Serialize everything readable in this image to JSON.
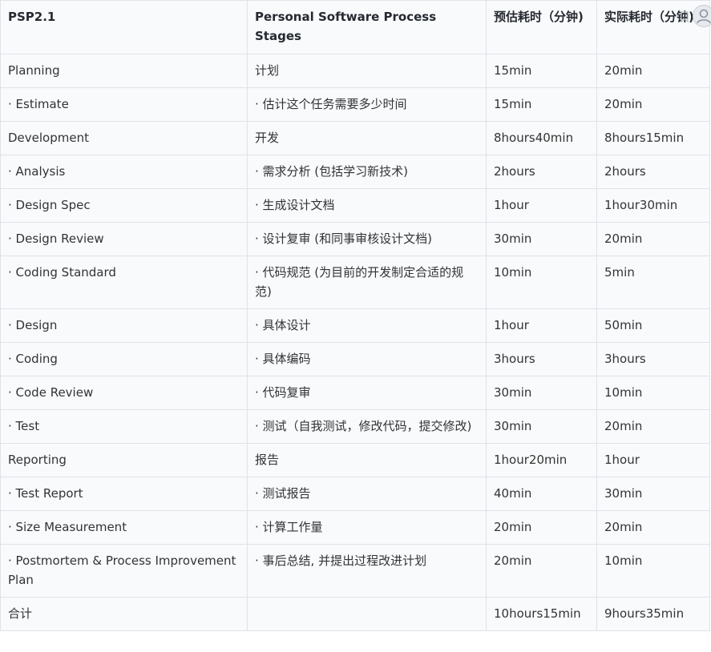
{
  "table": {
    "headers": [
      "PSP2.1",
      "Personal Software Process Stages",
      "预估耗时（分钟)",
      "实际耗时（分钟)"
    ],
    "rows": [
      [
        "Planning",
        "计划",
        "15min",
        "20min"
      ],
      [
        "· Estimate",
        "· 估计这个任务需要多少时间",
        "15min",
        "20min"
      ],
      [
        "Development",
        "开发",
        "8hours40min",
        "8hours15min"
      ],
      [
        "· Analysis",
        "· 需求分析 (包括学习新技术)",
        "2hours",
        "2hours"
      ],
      [
        "· Design Spec",
        "· 生成设计文档",
        "1hour",
        "1hour30min"
      ],
      [
        "· Design Review",
        "· 设计复审 (和同事审核设计文档)",
        "30min",
        "20min"
      ],
      [
        "· Coding Standard",
        "· 代码规范 (为目前的开发制定合适的规范)",
        "10min",
        "5min"
      ],
      [
        "· Design",
        "· 具体设计",
        "1hour",
        "50min"
      ],
      [
        "· Coding",
        "· 具体编码",
        "3hours",
        "3hours"
      ],
      [
        "· Code Review",
        "· 代码复审",
        "30min",
        "10min"
      ],
      [
        "· Test",
        "· 测试（自我测试，修改代码，提交修改)",
        "30min",
        "20min"
      ],
      [
        "Reporting",
        "报告",
        "1hour20min",
        "1hour"
      ],
      [
        "· Test Report",
        "· 测试报告",
        "40min",
        "30min"
      ],
      [
        "· Size Measurement",
        "· 计算工作量",
        "20min",
        "20min"
      ],
      [
        "· Postmortem & Process Improvement Plan",
        "· 事后总结, 并提出过程改进计划",
        "20min",
        "10min"
      ],
      [
        "合计",
        "",
        "10hours15min",
        "9hours35min"
      ]
    ]
  },
  "icons": {
    "avatar": "user-avatar-icon",
    "bookmark": "bookmark-icon"
  },
  "colors": {
    "cell_background": "#f8fafc",
    "border": "#dfe3e8",
    "text": "#333333",
    "header_text": "#262a30"
  }
}
